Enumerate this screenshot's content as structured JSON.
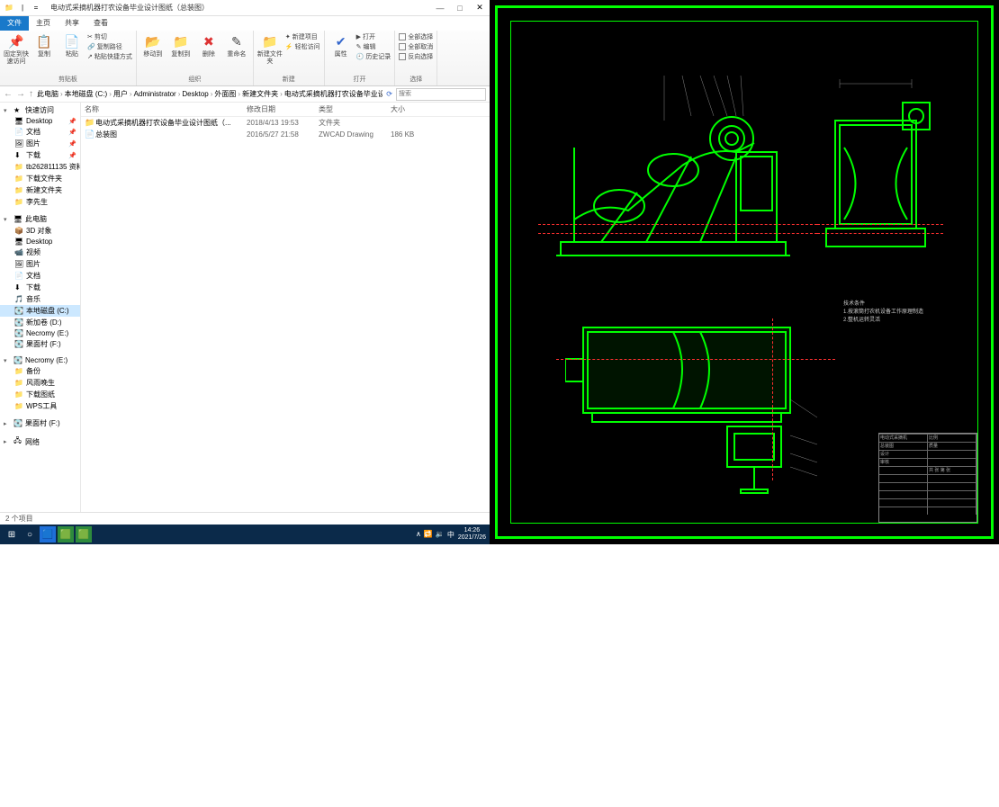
{
  "window": {
    "title": "电动式采摘机器打农设备毕业设计图纸（总装图）",
    "min": "—",
    "max": "□",
    "close": "✕"
  },
  "qat": {
    "folder": "📁",
    "eq": "="
  },
  "tabs": {
    "file": "文件",
    "home": "主页",
    "share": "共享",
    "view": "查看"
  },
  "ribbon": {
    "g1": {
      "pin": "固定到快速访问",
      "label": "剪贴板"
    },
    "g2": {
      "copy": "复制",
      "paste": "粘贴",
      "cut": "剪切",
      "path": "复制路径",
      "shortcut": "粘贴快捷方式"
    },
    "g3": {
      "move": "移动到",
      "copyto": "复制到",
      "delete": "删除",
      "rename": "重命名",
      "label": "组织"
    },
    "g4": {
      "newfolder": "新建文件夹",
      "newitem": "新建项目",
      "easy": "轻松访问",
      "label": "新建"
    },
    "g5": {
      "props": "属性",
      "open": "打开",
      "edit": "编辑",
      "history": "历史记录",
      "label": "打开"
    },
    "g6": {
      "all": "全部选择",
      "none": "全部取消",
      "invert": "反向选择",
      "label": "选择"
    }
  },
  "breadcrumbs": [
    "此电脑",
    "本地磁盘 (C:)",
    "用户",
    "Administrator",
    "Desktop",
    "外面图",
    "新建文件夹",
    "电动式采摘机器打农设备毕业设计图纸（总装图）"
  ],
  "search_ph": "搜索",
  "columns": {
    "name": "名称",
    "date": "修改日期",
    "type": "类型",
    "size": "大小"
  },
  "files": [
    {
      "icon": "📁",
      "name": "电动式采摘机器打农设备毕业设计图纸（...",
      "date": "2018/4/13 19:53",
      "type": "文件夹",
      "size": ""
    },
    {
      "icon": "📄",
      "name": "总装图",
      "date": "2016/5/27 21:58",
      "type": "ZWCAD Drawing",
      "size": "186 KB"
    }
  ],
  "nav": {
    "quick": "快速访问",
    "items1": [
      {
        "ic": "🖥",
        "t": "Desktop",
        "pin": "📌"
      },
      {
        "ic": "📄",
        "t": "文档",
        "pin": "📌"
      },
      {
        "ic": "🖼",
        "t": "图片",
        "pin": "📌"
      },
      {
        "ic": "⬇",
        "t": "下载",
        "pin": "📌"
      },
      {
        "ic": "📁",
        "t": "tb262811135 资料",
        "pin": ""
      },
      {
        "ic": "📁",
        "t": "下载文件夹",
        "pin": ""
      },
      {
        "ic": "📁",
        "t": "新建文件夹",
        "pin": ""
      },
      {
        "ic": "📁",
        "t": "李先生",
        "pin": ""
      }
    ],
    "thispc": "此电脑",
    "items2": [
      {
        "ic": "📦",
        "t": "3D 对象"
      },
      {
        "ic": "🖥",
        "t": "Desktop"
      },
      {
        "ic": "📹",
        "t": "视频"
      },
      {
        "ic": "🖼",
        "t": "图片"
      },
      {
        "ic": "📄",
        "t": "文档"
      },
      {
        "ic": "⬇",
        "t": "下载"
      },
      {
        "ic": "🎵",
        "t": "音乐"
      },
      {
        "ic": "💽",
        "t": "本地磁盘 (C:)",
        "sel": true
      },
      {
        "ic": "💽",
        "t": "新加卷 (D:)"
      },
      {
        "ic": "💽",
        "t": "Necromy (E:)"
      },
      {
        "ic": "💽",
        "t": "果面村 (F:)"
      }
    ],
    "necromy": "Necromy (E:)",
    "items3": [
      {
        "ic": "📁",
        "t": "备份"
      },
      {
        "ic": "📁",
        "t": "风雨晚生"
      },
      {
        "ic": "📁",
        "t": "下载图纸"
      },
      {
        "ic": "📁",
        "t": "WPS工具"
      }
    ],
    "guomian": "果面村 (F:)",
    "network": "网络"
  },
  "status": "2 个项目",
  "taskbar": {
    "icons": [
      "⊞",
      "○",
      "🟦",
      "🟩",
      "🟩"
    ],
    "tray": [
      "∧",
      "🔁",
      "🔉",
      "中"
    ],
    "time": "14:26",
    "date": "2021/7/26"
  },
  "cad": {
    "note1": "技术条件",
    "note2": "1.按滚筒打农机设备工作原理制造",
    "note3": "2.整机运转灵活",
    "tb": [
      "比例",
      "质量",
      "共 张 第 张",
      "设计",
      "审核",
      "电动式采摘机",
      "总装图"
    ]
  }
}
